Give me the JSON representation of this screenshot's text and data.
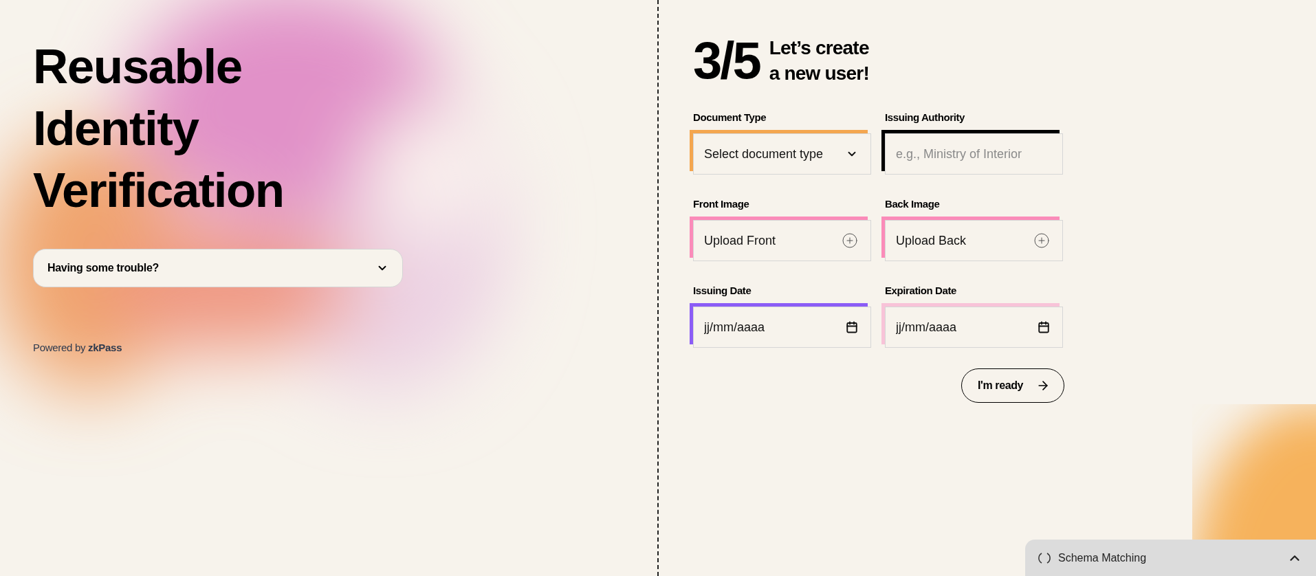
{
  "hero": {
    "title_lines": [
      "Reusable",
      "Identity",
      "Verification"
    ],
    "help": {
      "label": "Having some trouble?",
      "expanded": false
    },
    "powered_by": {
      "prefix": "Powered by",
      "brand": "zkPass"
    }
  },
  "form": {
    "step": "3/5",
    "heading_lines": [
      "Let’s create",
      "a new user!"
    ],
    "fields": [
      {
        "label": "Document Type",
        "kind": "select",
        "text": "Select document type",
        "color": "#f4a64f"
      },
      {
        "label": "Issuing Authority",
        "kind": "text",
        "placeholder": "e.g., Ministry of Interior",
        "color": "#000000"
      },
      {
        "label": "Front Image",
        "kind": "upload",
        "text": "Upload Front",
        "color": "#fb8bb9"
      },
      {
        "label": "Back Image",
        "kind": "upload",
        "text": "Upload Back",
        "color": "#fb8bb9"
      },
      {
        "label": "Issuing Date",
        "kind": "date",
        "placeholder": "jj/mm/aaaa",
        "color": "#8b5cf6"
      },
      {
        "label": "Expiration Date",
        "kind": "date",
        "placeholder": "jj/mm/aaaa",
        "color": "#f8c3d8"
      }
    ],
    "submit": "I'm ready"
  },
  "status_panel": {
    "label": "Schema Matching",
    "expanded": false
  }
}
